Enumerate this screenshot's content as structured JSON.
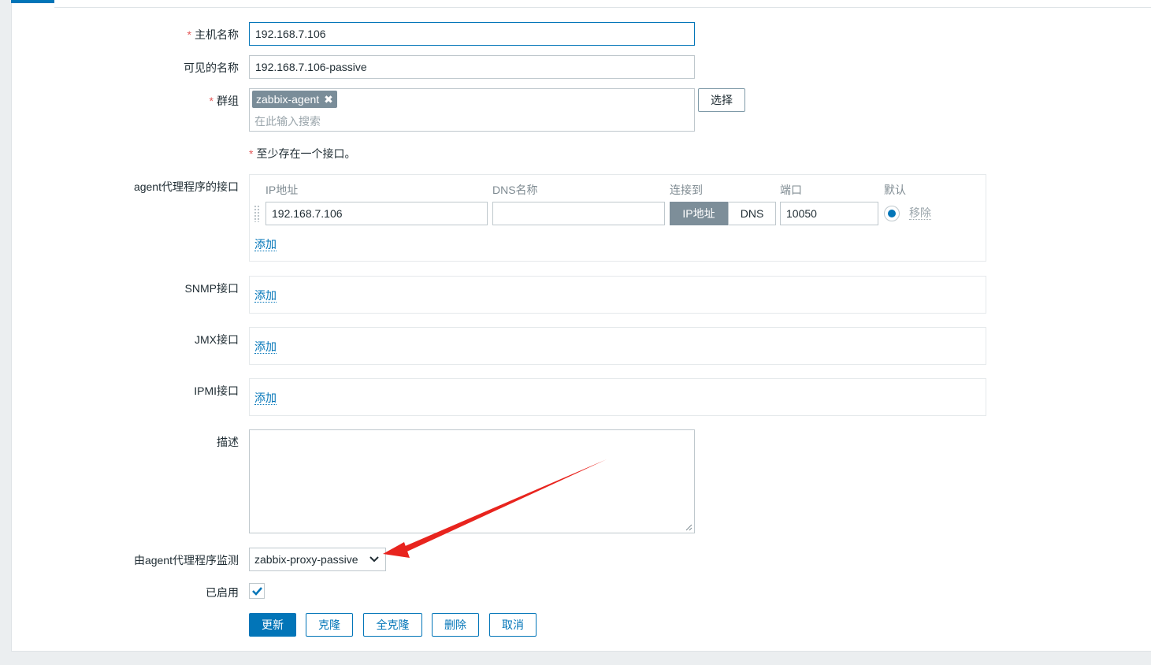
{
  "colors": {
    "accent": "#0275b8",
    "required": "#e45959",
    "tag_bg": "#7a8d99",
    "arrow": "#e8241e"
  },
  "form": {
    "host_name": {
      "label": "主机名称",
      "value": "192.168.7.106"
    },
    "visible_name": {
      "label": "可见的名称",
      "value": "192.168.7.106-passive"
    },
    "groups": {
      "label": "群组",
      "tag": "zabbix-agent",
      "search_placeholder": "在此输入搜索",
      "select_label": "选择"
    },
    "interface_notice": "至少存在一个接口。",
    "agent_interfaces": {
      "label": "agent代理程序的接口",
      "columns": {
        "ip": "IP地址",
        "dns": "DNS名称",
        "connect": "连接到",
        "port": "端口",
        "default": "默认"
      },
      "row": {
        "ip": "192.168.7.106",
        "dns": "",
        "connect_ip": "IP地址",
        "connect_dns": "DNS",
        "port": "10050",
        "remove": "移除"
      },
      "add": "添加"
    },
    "snmp": {
      "label": "SNMP接口",
      "add": "添加"
    },
    "jmx": {
      "label": "JMX接口",
      "add": "添加"
    },
    "ipmi": {
      "label": "IPMI接口",
      "add": "添加"
    },
    "description": {
      "label": "描述",
      "value": ""
    },
    "monitored_by": {
      "label": "由agent代理程序监测",
      "selected": "zabbix-proxy-passive"
    },
    "enabled": {
      "label": "已启用",
      "checked": true
    }
  },
  "buttons": {
    "update": "更新",
    "clone": "克隆",
    "full_clone": "全克隆",
    "delete": "删除",
    "cancel": "取消"
  }
}
